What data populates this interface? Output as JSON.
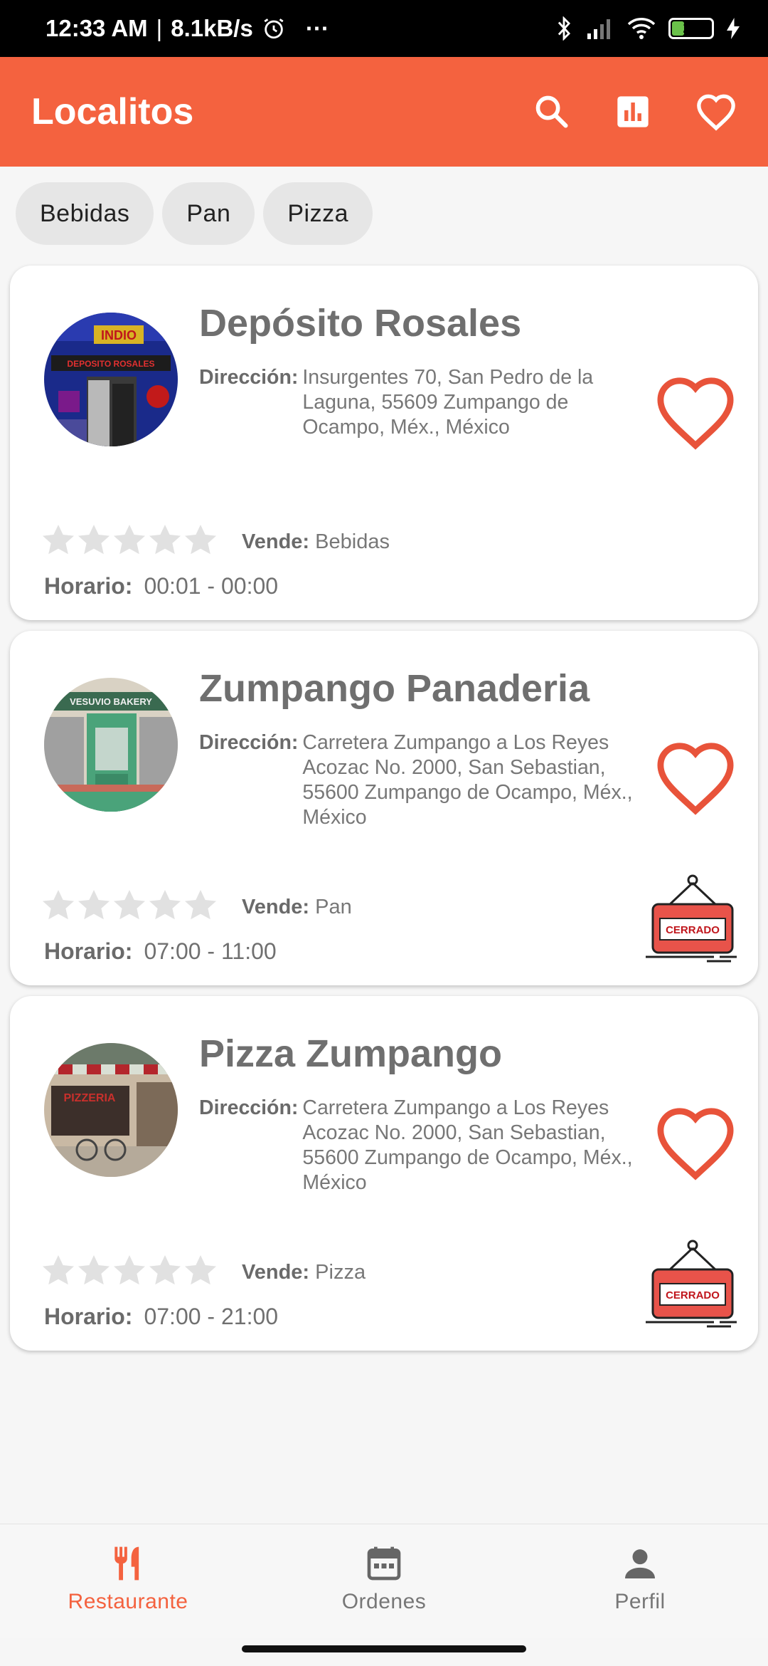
{
  "status_bar": {
    "time": "12:33 AM",
    "speed": "8.1kB/s",
    "more": "···",
    "battery": "29"
  },
  "app_bar": {
    "title": "Localitos",
    "icons": [
      "search-icon",
      "bar-chart-icon",
      "heart-icon"
    ]
  },
  "colors": {
    "primary": "#f4623f",
    "card_text": "#6f6f6f"
  },
  "chips": [
    {
      "label": "Bebidas"
    },
    {
      "label": "Pan"
    },
    {
      "label": "Pizza"
    }
  ],
  "cards": [
    {
      "name": "Depósito Rosales",
      "address_label": "Dirección:",
      "address": "Insurgentes 70, San Pedro de la Laguna, 55609 Zumpango de Ocampo, Méx., México",
      "rating_stars": 0,
      "sells_label": "Vende:",
      "sells": "Bebidas",
      "hours_label": "Horario:",
      "hours": "00:01 - 00:00",
      "closed_sign": ""
    },
    {
      "name": "Zumpango Panaderia",
      "address_label": "Dirección:",
      "address": "Carretera Zumpango a Los Reyes Acozac No. 2000, San Sebastian, 55600 Zumpango de Ocampo, Méx., México",
      "rating_stars": 0,
      "sells_label": "Vende:",
      "sells": "Pan",
      "hours_label": "Horario:",
      "hours": "07:00 - 11:00",
      "closed_sign": "CERRADO"
    },
    {
      "name": "Pizza Zumpango",
      "address_label": "Dirección:",
      "address": "Carretera Zumpango a Los Reyes Acozac No. 2000, San Sebastian, 55600 Zumpango de Ocampo, Méx., México",
      "rating_stars": 0,
      "sells_label": "Vende:",
      "sells": "Pizza",
      "hours_label": "Horario:",
      "hours": "07:00 - 21:00",
      "closed_sign": "CERRADO"
    }
  ],
  "bottom_nav": [
    {
      "label": "Restaurante",
      "icon": "restaurant-icon",
      "active": true
    },
    {
      "label": "Ordenes",
      "icon": "calendar-icon",
      "active": false
    },
    {
      "label": "Perfil",
      "icon": "person-icon",
      "active": false
    }
  ]
}
